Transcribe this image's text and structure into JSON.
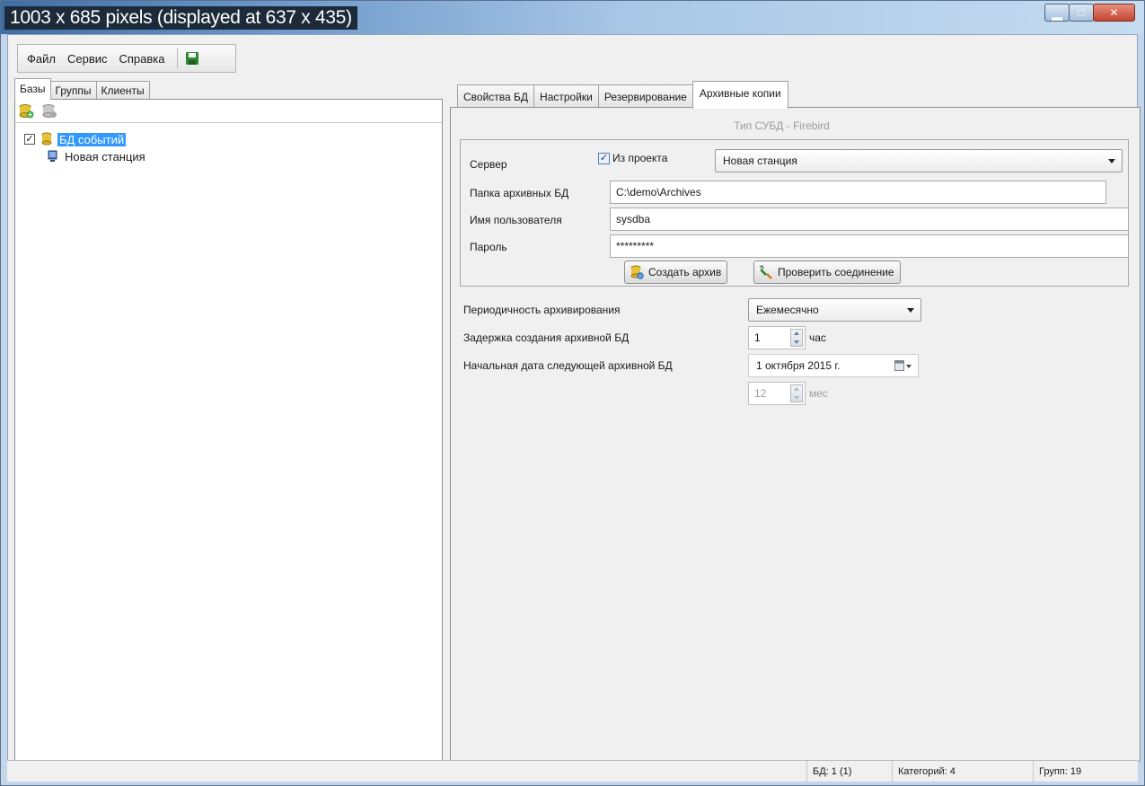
{
  "window": {
    "title": "1003 x 685 pixels (displayed at 637 x 435)"
  },
  "menu": {
    "items": [
      "Файл",
      "Сервис",
      "Справка"
    ]
  },
  "left_tabs": [
    "Базы",
    "Группы",
    "Клиенты"
  ],
  "tree": {
    "root": "БД событий",
    "child": "Новая станция",
    "root_checked": true
  },
  "right_tabs": [
    "Свойства БД",
    "Настройки",
    "Резервирование",
    "Архивные копии"
  ],
  "db_type": "Тип СУБД - Firebird",
  "form": {
    "server_label": "Сервер",
    "from_project_label": "Из проекта",
    "from_project_checked": true,
    "server_value": "Новая станция",
    "archive_folder_label": "Папка архивных БД",
    "archive_folder_value": "C:\\demo\\Archives",
    "username_label": "Имя пользователя",
    "username_value": "sysdba",
    "password_label": "Пароль",
    "password_value": "*********",
    "create_archive_button": "Создать архив",
    "check_connection_button": "Проверить соединение"
  },
  "schedule": {
    "period_label": "Периодичность архивирования",
    "period_value": "Ежемесячно",
    "delay_label": "Задержка создания архивной БД",
    "delay_value": "1",
    "delay_unit": "час",
    "start_date_label": "Начальная дата следующей архивной БД",
    "start_date_value": "1 октября  2015 г.",
    "months_value": "12",
    "months_unit": "мес"
  },
  "status": {
    "db": "БД: 1 (1)",
    "categories": "Категорий: 4",
    "groups": "Групп: 19"
  }
}
